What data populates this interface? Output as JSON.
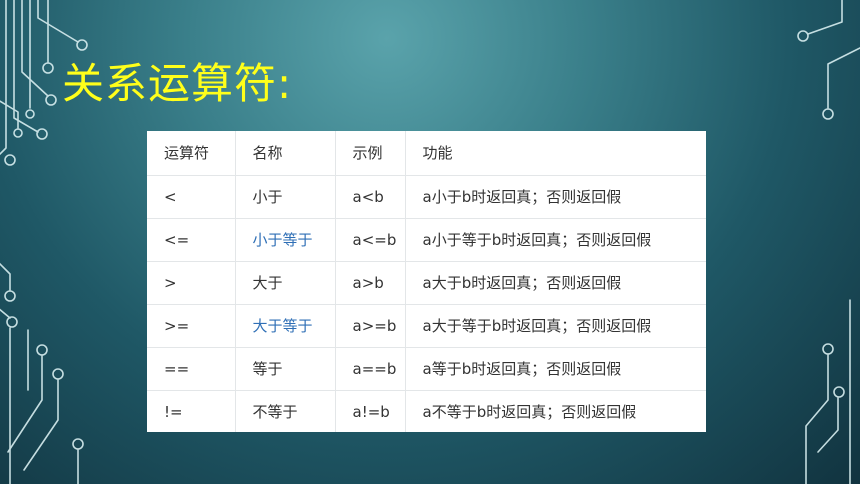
{
  "title": "关系运算符:",
  "colors": {
    "title": "#ffff1a",
    "link": "#2f6fb6",
    "background": "#2d6c78",
    "circuit": "#d8eef0"
  },
  "table": {
    "headers": [
      "运算符",
      "名称",
      "示例",
      "功能"
    ],
    "rows": [
      {
        "op": "<",
        "name": "小于",
        "name_link": false,
        "example": "a<b",
        "desc": "a小于b时返回真；否则返回假"
      },
      {
        "op": "<=",
        "name": "小于等于",
        "name_link": true,
        "example": "a<=b",
        "desc": "a小于等于b时返回真；否则返回假"
      },
      {
        "op": ">",
        "name": "大于",
        "name_link": false,
        "example": "a>b",
        "desc": "a大于b时返回真；否则返回假"
      },
      {
        "op": ">=",
        "name": "大于等于",
        "name_link": true,
        "example": "a>=b",
        "desc": "a大于等于b时返回真；否则返回假"
      },
      {
        "op": "==",
        "name": "等于",
        "name_link": false,
        "example": "a==b",
        "desc": "a等于b时返回真；否则返回假"
      },
      {
        "op": "!=",
        "name": "不等于",
        "name_link": false,
        "example": "a!=b",
        "desc": "a不等于b时返回真；否则返回假"
      }
    ]
  }
}
